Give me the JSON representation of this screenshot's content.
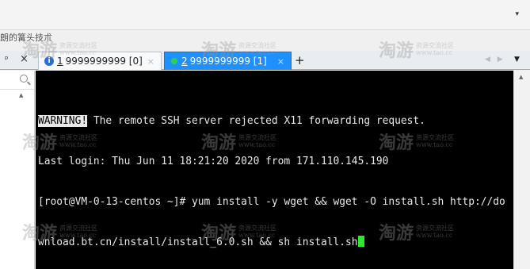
{
  "top_bar": {
    "dropdown_icon": "▾"
  },
  "left_pane": {
    "cut_label": "朗的篝头技朮"
  },
  "tabs": [
    {
      "index": "1",
      "label": " 9999999999 [0]",
      "close": "×",
      "active": false
    },
    {
      "index": "2",
      "label": " 9999999999 [1]",
      "close": "×",
      "active": true
    }
  ],
  "tab_bar": {
    "pin_icon": "ᵖ",
    "pane_close": "×",
    "add_tab": "+",
    "nav_arrows": "◀ ▶",
    "menu_arrow": "▼"
  },
  "terminal": {
    "warning_tag": "WARNING!",
    "line1_rest": " The remote SSH server rejected X11 forwarding request.",
    "line2": "Last login: Thu Jun 11 18:21:20 2020 from 171.110.145.190",
    "line3": "[root@VM-0-13-centos ~]# yum install -y wget && wget -O install.sh http://do",
    "line4": "wnload.bt.cn/install/install_6.0.sh && sh install.sh",
    "cursor_color": "#2ee82e"
  },
  "watermark": {
    "big": "淘游",
    "line1": "资源交流社区",
    "line2": "www.tao.cc"
  },
  "colors": {
    "active_tab": "#1e90ff",
    "terminal_bg": "#000000",
    "status_green": "#2fd14a"
  }
}
